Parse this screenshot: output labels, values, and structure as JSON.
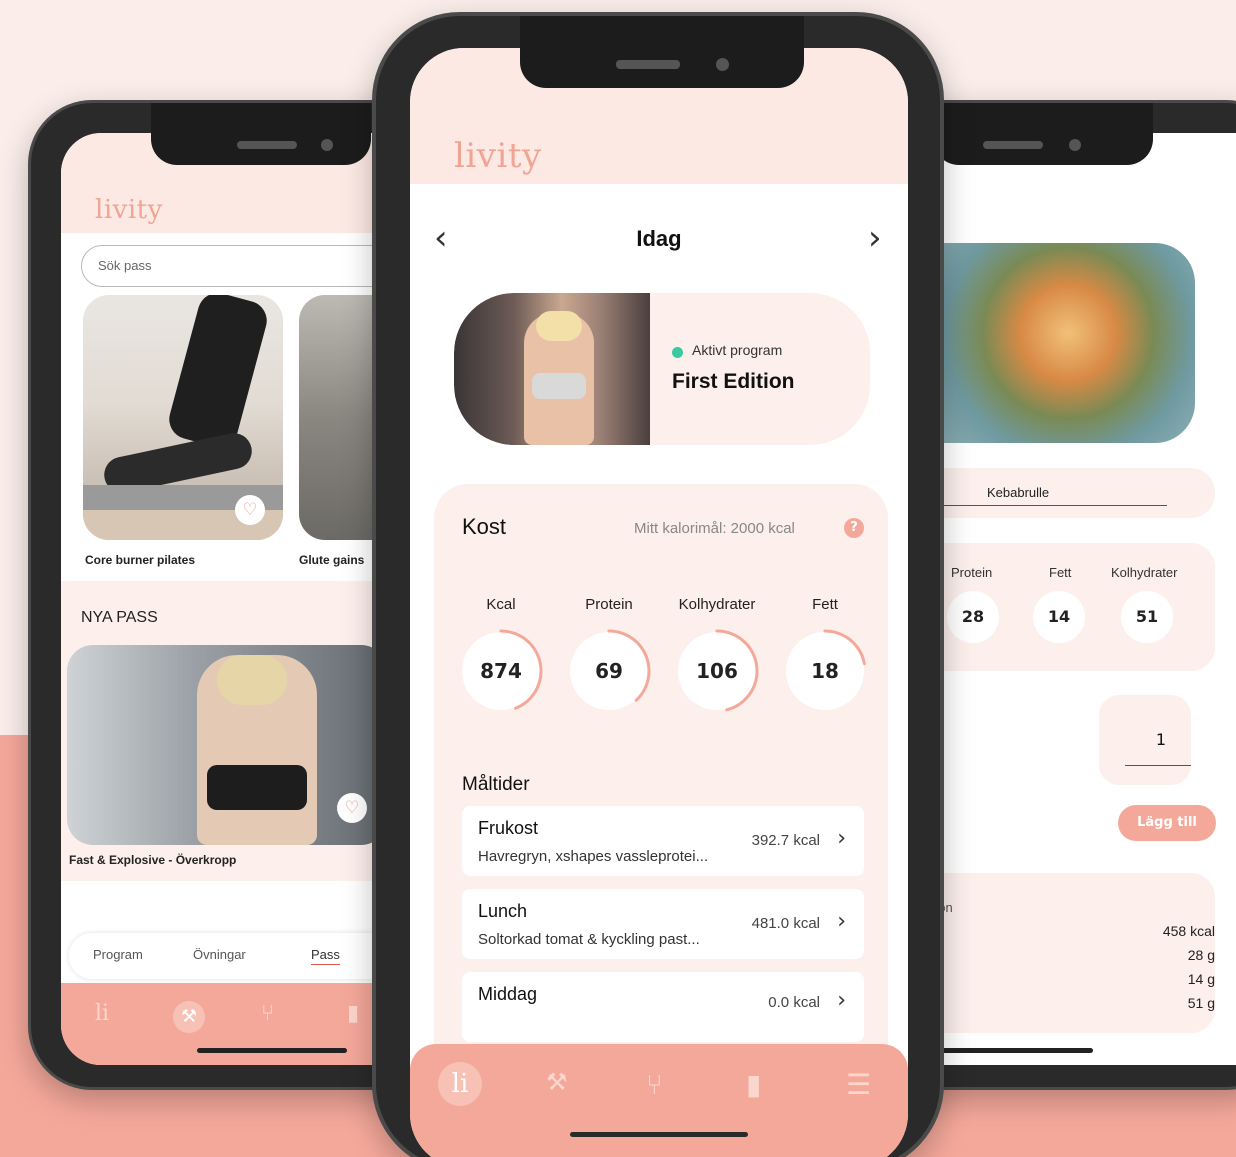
{
  "left_phone": {
    "logo": "livity",
    "search_placeholder": "Sök pass",
    "cards": [
      {
        "caption": "Core burner pilates"
      },
      {
        "caption": "Glute gains"
      }
    ],
    "section_title": "NYA PASS",
    "featured_caption": "Fast & Explosive - Överkropp",
    "tabs": [
      "Program",
      "Övningar",
      "Pass"
    ],
    "active_tab": "Pass",
    "nav_logo": "li"
  },
  "center_phone": {
    "logo": "livity",
    "day_title": "Idag",
    "program": {
      "status": "Aktivt program",
      "name": "First Edition"
    },
    "kost": {
      "title": "Kost",
      "calorie_goal": "Mitt kalorimål: 2000 kcal",
      "help": "?",
      "macros": [
        {
          "label": "Kcal",
          "value": "874",
          "progress": 0.44
        },
        {
          "label": "Protein",
          "value": "69",
          "progress": 0.38
        },
        {
          "label": "Kolhydrater",
          "value": "106",
          "progress": 0.46
        },
        {
          "label": "Fett",
          "value": "18",
          "progress": 0.22
        }
      ]
    },
    "meals_title": "Måltider",
    "meals": [
      {
        "name": "Frukost",
        "desc": "Havregryn, xshapes vassleprotei...",
        "kcal": "392.7 kcal"
      },
      {
        "name": "Lunch",
        "desc": "Soltorkad tomat & kyckling past...",
        "kcal": "481.0 kcal"
      },
      {
        "name": "Middag",
        "desc": "",
        "kcal": "0.0 kcal"
      }
    ],
    "nav_logo": "li"
  },
  "right_phone": {
    "food_name": "Kebabrulle",
    "macros": [
      {
        "label": "Protein",
        "value": "28"
      },
      {
        "label": "Fett",
        "value": "14"
      },
      {
        "label": "Kolhydrater",
        "value": "51"
      }
    ],
    "quantity": "1",
    "add_button": "Lägg till",
    "portion_label": "r portion",
    "nutrition": [
      "458 kcal",
      "28 g",
      "14 g",
      "51 g"
    ]
  },
  "colors": {
    "accent": "#f4a89a",
    "header_bg": "#fde9e4",
    "card_bg": "#fcefec",
    "active_dot": "#3cc9a0"
  }
}
